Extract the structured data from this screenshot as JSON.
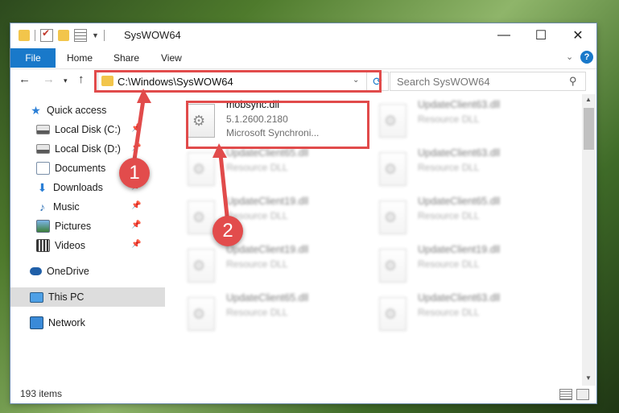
{
  "window": {
    "title": "SysWOW64",
    "controls": {
      "minimize": "—",
      "maximize": "☐",
      "close": "✕"
    }
  },
  "ribbon": {
    "tabs": [
      "File",
      "Home",
      "Share",
      "View"
    ],
    "collapse_icon": "chevron-down-icon",
    "help_label": "?"
  },
  "navigation": {
    "back": "←",
    "forward": "→",
    "recent": "▾",
    "up": "↑",
    "address": "C:\\Windows\\SysWOW64",
    "search_placeholder": "Search SysWOW64"
  },
  "sidebar": {
    "items": [
      {
        "label": "Quick access",
        "icon": "star-icon"
      },
      {
        "label": "Local Disk (C:)",
        "icon": "drive-icon",
        "pinned": true
      },
      {
        "label": "Local Disk (D:)",
        "icon": "drive-icon",
        "pinned": true
      },
      {
        "label": "Documents",
        "icon": "documents-icon",
        "pinned": true
      },
      {
        "label": "Downloads",
        "icon": "downloads-icon",
        "pinned": true
      },
      {
        "label": "Music",
        "icon": "music-icon",
        "pinned": true
      },
      {
        "label": "Pictures",
        "icon": "pictures-icon",
        "pinned": true
      },
      {
        "label": "Videos",
        "icon": "videos-icon",
        "pinned": true
      },
      {
        "label": "OneDrive",
        "icon": "onedrive-icon"
      },
      {
        "label": "This PC",
        "icon": "pc-icon",
        "selected": true
      },
      {
        "label": "Network",
        "icon": "network-icon"
      }
    ]
  },
  "files": [
    {
      "name": "mobsync.dll",
      "version": "5.1.2600.2180",
      "description": "Microsoft Synchroni..."
    },
    {
      "name": "UpdateClient63.dll",
      "description": "Resource DLL"
    },
    {
      "name": "UpdateClient65.dll",
      "description": "Resource DLL"
    },
    {
      "name": "UpdateClient63.dll",
      "description": "Resource DLL"
    },
    {
      "name": "UpdateClient19.dll",
      "description": "Resource DLL"
    },
    {
      "name": "UpdateClient65.dll",
      "description": "Resource DLL"
    },
    {
      "name": "UpdateClient19.dll",
      "description": "Resource DLL"
    },
    {
      "name": "UpdateClient19.dll",
      "description": "Resource DLL"
    },
    {
      "name": "UpdateClient65.dll",
      "description": "Resource DLL"
    },
    {
      "name": "UpdateClient63.dll",
      "description": "Resource DLL"
    }
  ],
  "status": {
    "item_count": "193 items"
  },
  "annotations": {
    "step1": "1",
    "step2": "2",
    "color": "#e14b4b"
  }
}
